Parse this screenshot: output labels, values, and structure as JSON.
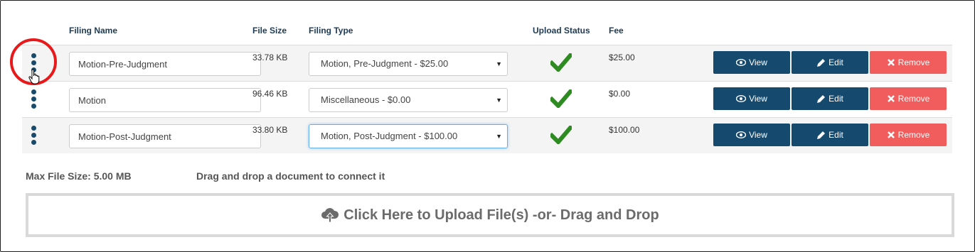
{
  "headers": {
    "filing_name": "Filing Name",
    "file_size": "File Size",
    "filing_type": "Filing Type",
    "upload_status": "Upload Status",
    "fee": "Fee"
  },
  "rows": [
    {
      "filing_name": "Motion-Pre-Judgment",
      "file_size": "33.78 KB",
      "filing_type": "Motion, Pre-Judgment - $25.00",
      "fee": "$25.00",
      "upload_status": "check-icon"
    },
    {
      "filing_name": "Motion",
      "file_size": "96.46 KB",
      "filing_type": "Miscellaneous - $0.00",
      "fee": "$0.00",
      "upload_status": "check-icon"
    },
    {
      "filing_name": "Motion-Post-Judgment",
      "file_size": "33.80 KB",
      "filing_type": "Motion, Post-Judgment - $100.00",
      "fee": "$100.00",
      "upload_status": "check-icon"
    }
  ],
  "buttons": {
    "view": "View",
    "edit": "Edit",
    "remove": "Remove"
  },
  "footer": {
    "max_file_size": "Max File Size: 5.00 MB",
    "drag_hint": "Drag and drop a document to connect it",
    "upload_label": "Click Here to Upload File(s) -or- Drag and Drop"
  },
  "colors": {
    "primary": "#154a6e",
    "danger": "#f15c5c",
    "success": "#2e8b22",
    "highlight": "#e8191b"
  }
}
